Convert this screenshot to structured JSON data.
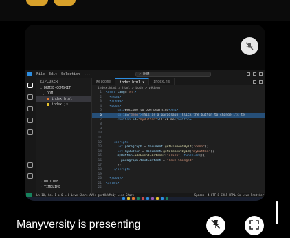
{
  "meeting": {
    "caption": "Manyversity is presenting",
    "icons": {
      "muted": "mic-off-icon",
      "unpin": "unpin-icon",
      "fullscreen": "fullscreen-icon"
    }
  },
  "vscode": {
    "menu": [
      "File",
      "Edit",
      "Selection",
      "..."
    ],
    "search_text": "DOM",
    "explorer_title": "EXPLORER",
    "tree": {
      "root": "DRMSE-COMSKIT",
      "folder": "DOM",
      "files": [
        "index.html",
        "index.js"
      ]
    },
    "outline_label": "OUTLINE",
    "timeline_label": "TIMELINE",
    "tabs": [
      "Welcome",
      "index.html",
      "index.js"
    ],
    "breadcrumb": "index.html > html > body > p#demo",
    "line_numbers": [
      "1",
      "2",
      "3",
      "4",
      "5",
      "6",
      "7",
      "8",
      "9",
      "10",
      "11",
      "12",
      "13",
      "14",
      "15",
      "16",
      "17",
      "18",
      "19",
      "20",
      "21",
      "22"
    ],
    "status_left": "Ln 10, Col 1   ⊗ 0 ⚠ 0   Live Share   AVX: gnrtHeWMeNy   Live Share",
    "status_right": "Spaces: 4   UTF-8   CRLF   HTML   Go Live   Prettier"
  },
  "colors": {
    "accent": "#2d8de0",
    "highlight": "#264f78",
    "remote": "#16825d"
  }
}
